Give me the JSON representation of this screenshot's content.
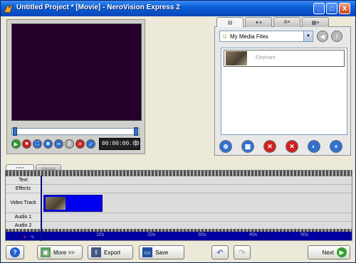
{
  "window": {
    "title": "Untitled Project * [Movie] - NeroVision Express 2",
    "controls": [
      "_",
      "□",
      "X"
    ]
  },
  "preview": {
    "timecode": "00:00:00.00",
    "playback_buttons": [
      {
        "name": "play",
        "color": "#2aa02a",
        "glyph": "▶"
      },
      {
        "name": "stop",
        "color": "#d02020",
        "glyph": "■"
      },
      {
        "name": "fullscreen",
        "color": "#3070d0",
        "glyph": "⛶"
      },
      {
        "name": "snapshot",
        "color": "#3070d0",
        "glyph": "◙"
      },
      {
        "name": "split",
        "color": "#3070d0",
        "glyph": "✂"
      },
      {
        "name": "trim",
        "color": "#b0b0b0",
        "glyph": "⫼"
      },
      {
        "name": "delete",
        "color": "#d02020",
        "glyph": "✕"
      },
      {
        "name": "apply",
        "color": "#3070d0",
        "glyph": "✓"
      }
    ]
  },
  "library": {
    "tabs": [
      "▤",
      "✦≡",
      "A≡",
      "▦≡"
    ],
    "source_select": "My Media Files",
    "items": [
      {
        "name": "Elephant"
      }
    ],
    "action_buttons": [
      {
        "name": "browse",
        "color": "#3070d0",
        "glyph": "⊕"
      },
      {
        "name": "film",
        "color": "#3070d0",
        "glyph": "▦"
      },
      {
        "name": "remove",
        "color": "#d02020",
        "glyph": "✕"
      },
      {
        "name": "remove-all",
        "color": "#d02020",
        "glyph": "✕"
      },
      {
        "name": "capture",
        "color": "#3070d0",
        "glyph": "◐"
      },
      {
        "name": "add",
        "color": "#3070d0",
        "glyph": "+"
      }
    ]
  },
  "timeline": {
    "tabs": [
      "▫▫▫▫▫",
      "▭▭▭"
    ],
    "tracks": [
      {
        "label": "Text"
      },
      {
        "label": "Effects"
      },
      {
        "label": "Video Track"
      },
      {
        "label": "Audio 1"
      },
      {
        "label": "Audio 2"
      }
    ],
    "ruler_ticks": [
      "10s",
      "20s",
      "30s",
      "40s",
      "50s"
    ]
  },
  "bottom_bar": {
    "help": "?",
    "more": "More >>",
    "export": "Export",
    "save": "Save",
    "next": "Next"
  }
}
